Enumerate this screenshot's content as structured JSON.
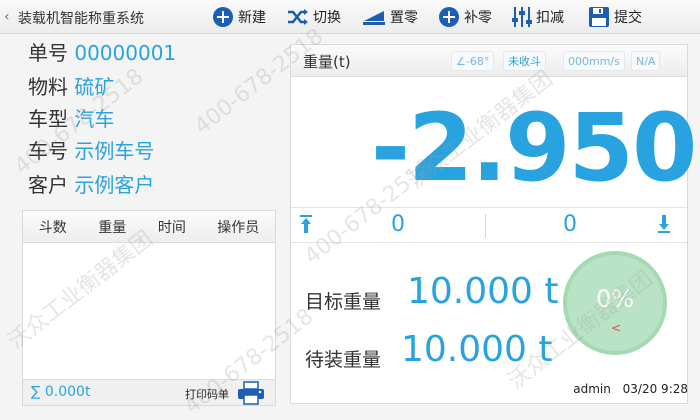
{
  "app": {
    "title": "装载机智能称重系统"
  },
  "toolbar": {
    "new_label": "新建",
    "switch_label": "切换",
    "zero_set_label": "置零",
    "zero_comp_label": "补零",
    "deduct_label": "扣减",
    "submit_label": "提交"
  },
  "info": {
    "order_label": "单号",
    "order_value": "00000001",
    "material_label": "物料",
    "material_value": "硫矿",
    "vehicle_label": "车型",
    "vehicle_value": "汽车",
    "plate_label": "车号",
    "plate_value": "示例车号",
    "customer_label": "客户",
    "customer_value": "示例客户"
  },
  "records": {
    "columns": [
      "斗数",
      "重量",
      "时间",
      "操作员"
    ],
    "rows": [],
    "total": "∑ 0.000t",
    "print_label": "打印码单"
  },
  "weight": {
    "title": "重量(t)",
    "angle": "∠-68°",
    "bucket_state": "未收斗",
    "speed": "000mm/s",
    "na": "N/A",
    "value": "-2.950",
    "lift_count_up": "0",
    "lift_count_down": "0",
    "target_label": "目标重量",
    "target_value": "10.000 t",
    "remaining_label": "待装重量",
    "remaining_value": "10.000 t",
    "progress_text": "0%",
    "progress_arrow": "<",
    "progress": 0
  },
  "footer": {
    "user": "admin",
    "datetime": "03/20 9:28"
  },
  "watermark": {
    "phone": "400-678-2518",
    "company": "沃众工业衡器集团"
  },
  "colors": {
    "accent": "#29a3e0",
    "toolbar_icon": "#1a5fb4",
    "progress_fill": "#b9e3c4",
    "progress_arrow": "#e04848"
  },
  "icons": {
    "back": "chevron-left-icon",
    "new": "plus-circle-icon",
    "switch": "shuffle-icon",
    "zero_set": "ramp-icon",
    "zero_comp": "plus-circle-icon",
    "deduct": "sliders-icon",
    "submit": "floppy-disk-icon",
    "print": "printer-icon",
    "up": "arrow-up-bar-icon",
    "down": "arrow-down-bar-icon"
  }
}
